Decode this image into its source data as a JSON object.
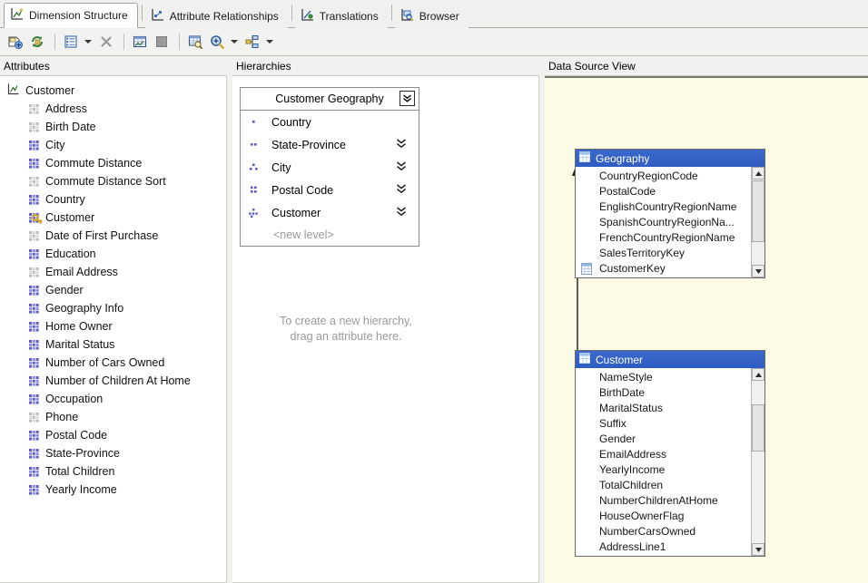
{
  "tabs": [
    {
      "label": "Dimension Structure",
      "icon": "dimension-structure-icon",
      "active": true
    },
    {
      "label": "Attribute Relationships",
      "icon": "attribute-relationships-icon",
      "active": false
    },
    {
      "label": "Translations",
      "icon": "translations-icon",
      "active": false
    },
    {
      "label": "Browser",
      "icon": "browser-icon",
      "active": false
    }
  ],
  "toolbar": {
    "buttons": [
      {
        "name": "show-dimension-designer-icon",
        "title": "Edit Dimension"
      },
      {
        "name": "process-refresh-icon",
        "title": "Process"
      },
      {
        "name": "properties-list-icon",
        "title": "Show Attributes In"
      },
      {
        "name": "dropdown-arrow-icon",
        "title": "More"
      },
      {
        "name": "delete-x-icon",
        "title": "Delete"
      },
      {
        "name": "show-grid-icon",
        "title": "Show Data Source View"
      },
      {
        "name": "stop-square-icon",
        "title": "Stop"
      },
      {
        "name": "find-table-icon",
        "title": "Find Table"
      },
      {
        "name": "zoom-icon",
        "title": "Zoom"
      },
      {
        "name": "zoom-dropdown-arrow-icon",
        "title": "Zoom Options"
      },
      {
        "name": "diagram-organizer-icon",
        "title": "Diagram Organizer"
      },
      {
        "name": "diagram-dropdown-arrow-icon",
        "title": "Diagram Options"
      }
    ]
  },
  "panels": {
    "attributes": {
      "title": "Attributes"
    },
    "hierarchies": {
      "title": "Hierarchies"
    },
    "dsv": {
      "title": "Data Source View"
    }
  },
  "attributes": {
    "root": {
      "label": "Customer",
      "icon": "dimension-icon"
    },
    "items": [
      {
        "label": "Address",
        "state": "disabled"
      },
      {
        "label": "Birth Date",
        "state": "disabled"
      },
      {
        "label": "City",
        "state": "enabled"
      },
      {
        "label": "Commute Distance",
        "state": "enabled"
      },
      {
        "label": "Commute Distance Sort",
        "state": "disabled"
      },
      {
        "label": "Country",
        "state": "enabled"
      },
      {
        "label": "Customer",
        "state": "key"
      },
      {
        "label": "Date of First Purchase",
        "state": "disabled"
      },
      {
        "label": "Education",
        "state": "enabled"
      },
      {
        "label": "Email Address",
        "state": "disabled"
      },
      {
        "label": "Gender",
        "state": "enabled"
      },
      {
        "label": "Geography Info",
        "state": "enabled"
      },
      {
        "label": "Home Owner",
        "state": "enabled"
      },
      {
        "label": "Marital Status",
        "state": "enabled"
      },
      {
        "label": "Number of Cars Owned",
        "state": "enabled"
      },
      {
        "label": "Number of Children At Home",
        "state": "enabled"
      },
      {
        "label": "Occupation",
        "state": "enabled"
      },
      {
        "label": "Phone",
        "state": "disabled"
      },
      {
        "label": "Postal Code",
        "state": "enabled"
      },
      {
        "label": "State-Province",
        "state": "enabled"
      },
      {
        "label": "Total Children",
        "state": "enabled"
      },
      {
        "label": "Yearly Income",
        "state": "enabled"
      }
    ]
  },
  "hierarchy": {
    "name": "Customer Geography",
    "dropdown_icon": "collapse-all-icon",
    "levels": [
      {
        "label": "Country",
        "dots": 1,
        "has_chevron": false
      },
      {
        "label": "State-Province",
        "dots": 2,
        "has_chevron": true
      },
      {
        "label": "City",
        "dots": 3,
        "has_chevron": true
      },
      {
        "label": "Postal Code",
        "dots": 4,
        "has_chevron": true
      },
      {
        "label": "Customer",
        "dots": 5,
        "has_chevron": true
      }
    ],
    "new_level_label": "<new level>",
    "drag_hint_line1": "To create a new hierarchy,",
    "drag_hint_line2": "drag an attribute here."
  },
  "dsv": {
    "tables": [
      {
        "name": "Geography",
        "icon": "table-icon",
        "columns": [
          {
            "label": "CountryRegionCode",
            "pk": false
          },
          {
            "label": "PostalCode",
            "pk": false
          },
          {
            "label": "EnglishCountryRegionName",
            "pk": false
          },
          {
            "label": "SpanishCountryRegionNa...",
            "pk": false
          },
          {
            "label": "FrenchCountryRegionName",
            "pk": false
          },
          {
            "label": "SalesTerritoryKey",
            "pk": false
          },
          {
            "label": "CustomerKey",
            "pk": true
          }
        ]
      },
      {
        "name": "Customer",
        "icon": "table-icon",
        "columns": [
          {
            "label": "NameStyle",
            "pk": false
          },
          {
            "label": "BirthDate",
            "pk": false
          },
          {
            "label": "MaritalStatus",
            "pk": false
          },
          {
            "label": "Suffix",
            "pk": false
          },
          {
            "label": "Gender",
            "pk": false
          },
          {
            "label": "EmailAddress",
            "pk": false
          },
          {
            "label": "YearlyIncome",
            "pk": false
          },
          {
            "label": "TotalChildren",
            "pk": false
          },
          {
            "label": "NumberChildrenAtHome",
            "pk": false
          },
          {
            "label": "HouseOwnerFlag",
            "pk": false
          },
          {
            "label": "NumberCarsOwned",
            "pk": false
          },
          {
            "label": "AddressLine1",
            "pk": false
          }
        ]
      }
    ],
    "relationship": {
      "from": "Customer",
      "to": "Geography",
      "name": "customer-to-geography-relationship"
    }
  },
  "colors": {
    "accent_blue": "#3366cc",
    "attribute_enabled": "#5b5bc8",
    "attribute_disabled": "#b9b9b9",
    "dsv_background": "#fdfbe6",
    "panel_header": "#f0f0ee"
  }
}
